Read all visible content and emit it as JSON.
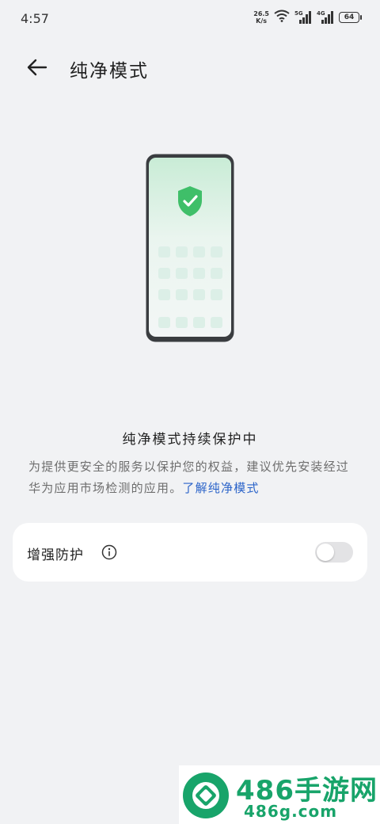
{
  "status_bar": {
    "time": "4:57",
    "net_speed_value": "26.5",
    "net_speed_unit": "K/s",
    "signal1_label": "5G",
    "signal2_label": "4G",
    "battery": "64"
  },
  "header": {
    "title": "纯净模式",
    "back_icon": "back-arrow-icon"
  },
  "illustration": {
    "icon": "shield-check-icon",
    "accent_color": "#3fbf69"
  },
  "status_message": {
    "title": "纯净模式持续保护中",
    "description": "为提供更安全的服务以保护您的权益，建议优先安装经过华为应用市场检测的应用。",
    "link_text": "了解纯净模式"
  },
  "settings": {
    "enhanced_protection_label": "增强防护",
    "enhanced_protection_enabled": false
  },
  "watermark": {
    "brand": "486手游网",
    "url": "486g.com",
    "color": "#18a46a"
  }
}
